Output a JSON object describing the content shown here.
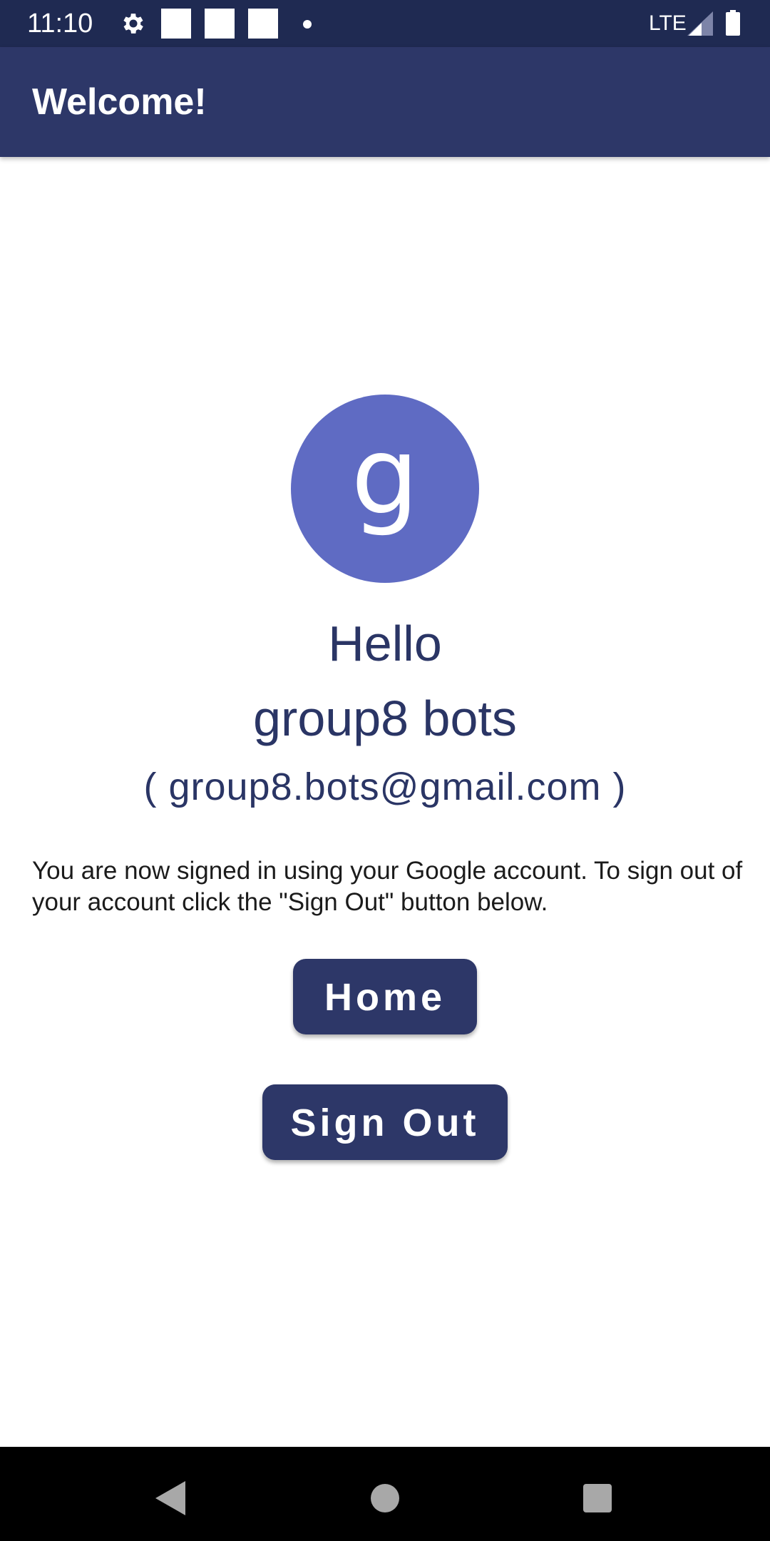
{
  "status_bar": {
    "time": "11:10",
    "network": "LTE",
    "icons": [
      "gear-icon",
      "notification-square-icon",
      "notification-square-icon",
      "notification-square-icon",
      "dot-icon",
      "signal-icon",
      "battery-icon"
    ]
  },
  "app_bar": {
    "title": "Welcome!"
  },
  "profile": {
    "avatar_letter": "g",
    "avatar_color": "#5f6bc3",
    "greeting": "Hello",
    "name": "group8 bots",
    "email": "( group8.bots@gmail.com )"
  },
  "info_text": "You are now signed in using your Google account. To sign out of your account click the \"Sign Out\" button below.",
  "buttons": {
    "home_label": "Home",
    "sign_out_label": "Sign Out"
  },
  "nav_bar": {
    "icons": [
      "back-icon",
      "home-icon",
      "recents-icon"
    ]
  },
  "colors": {
    "primary": "#2d3768",
    "status_bar": "#1f2a52",
    "text_accent": "#2a3565"
  }
}
